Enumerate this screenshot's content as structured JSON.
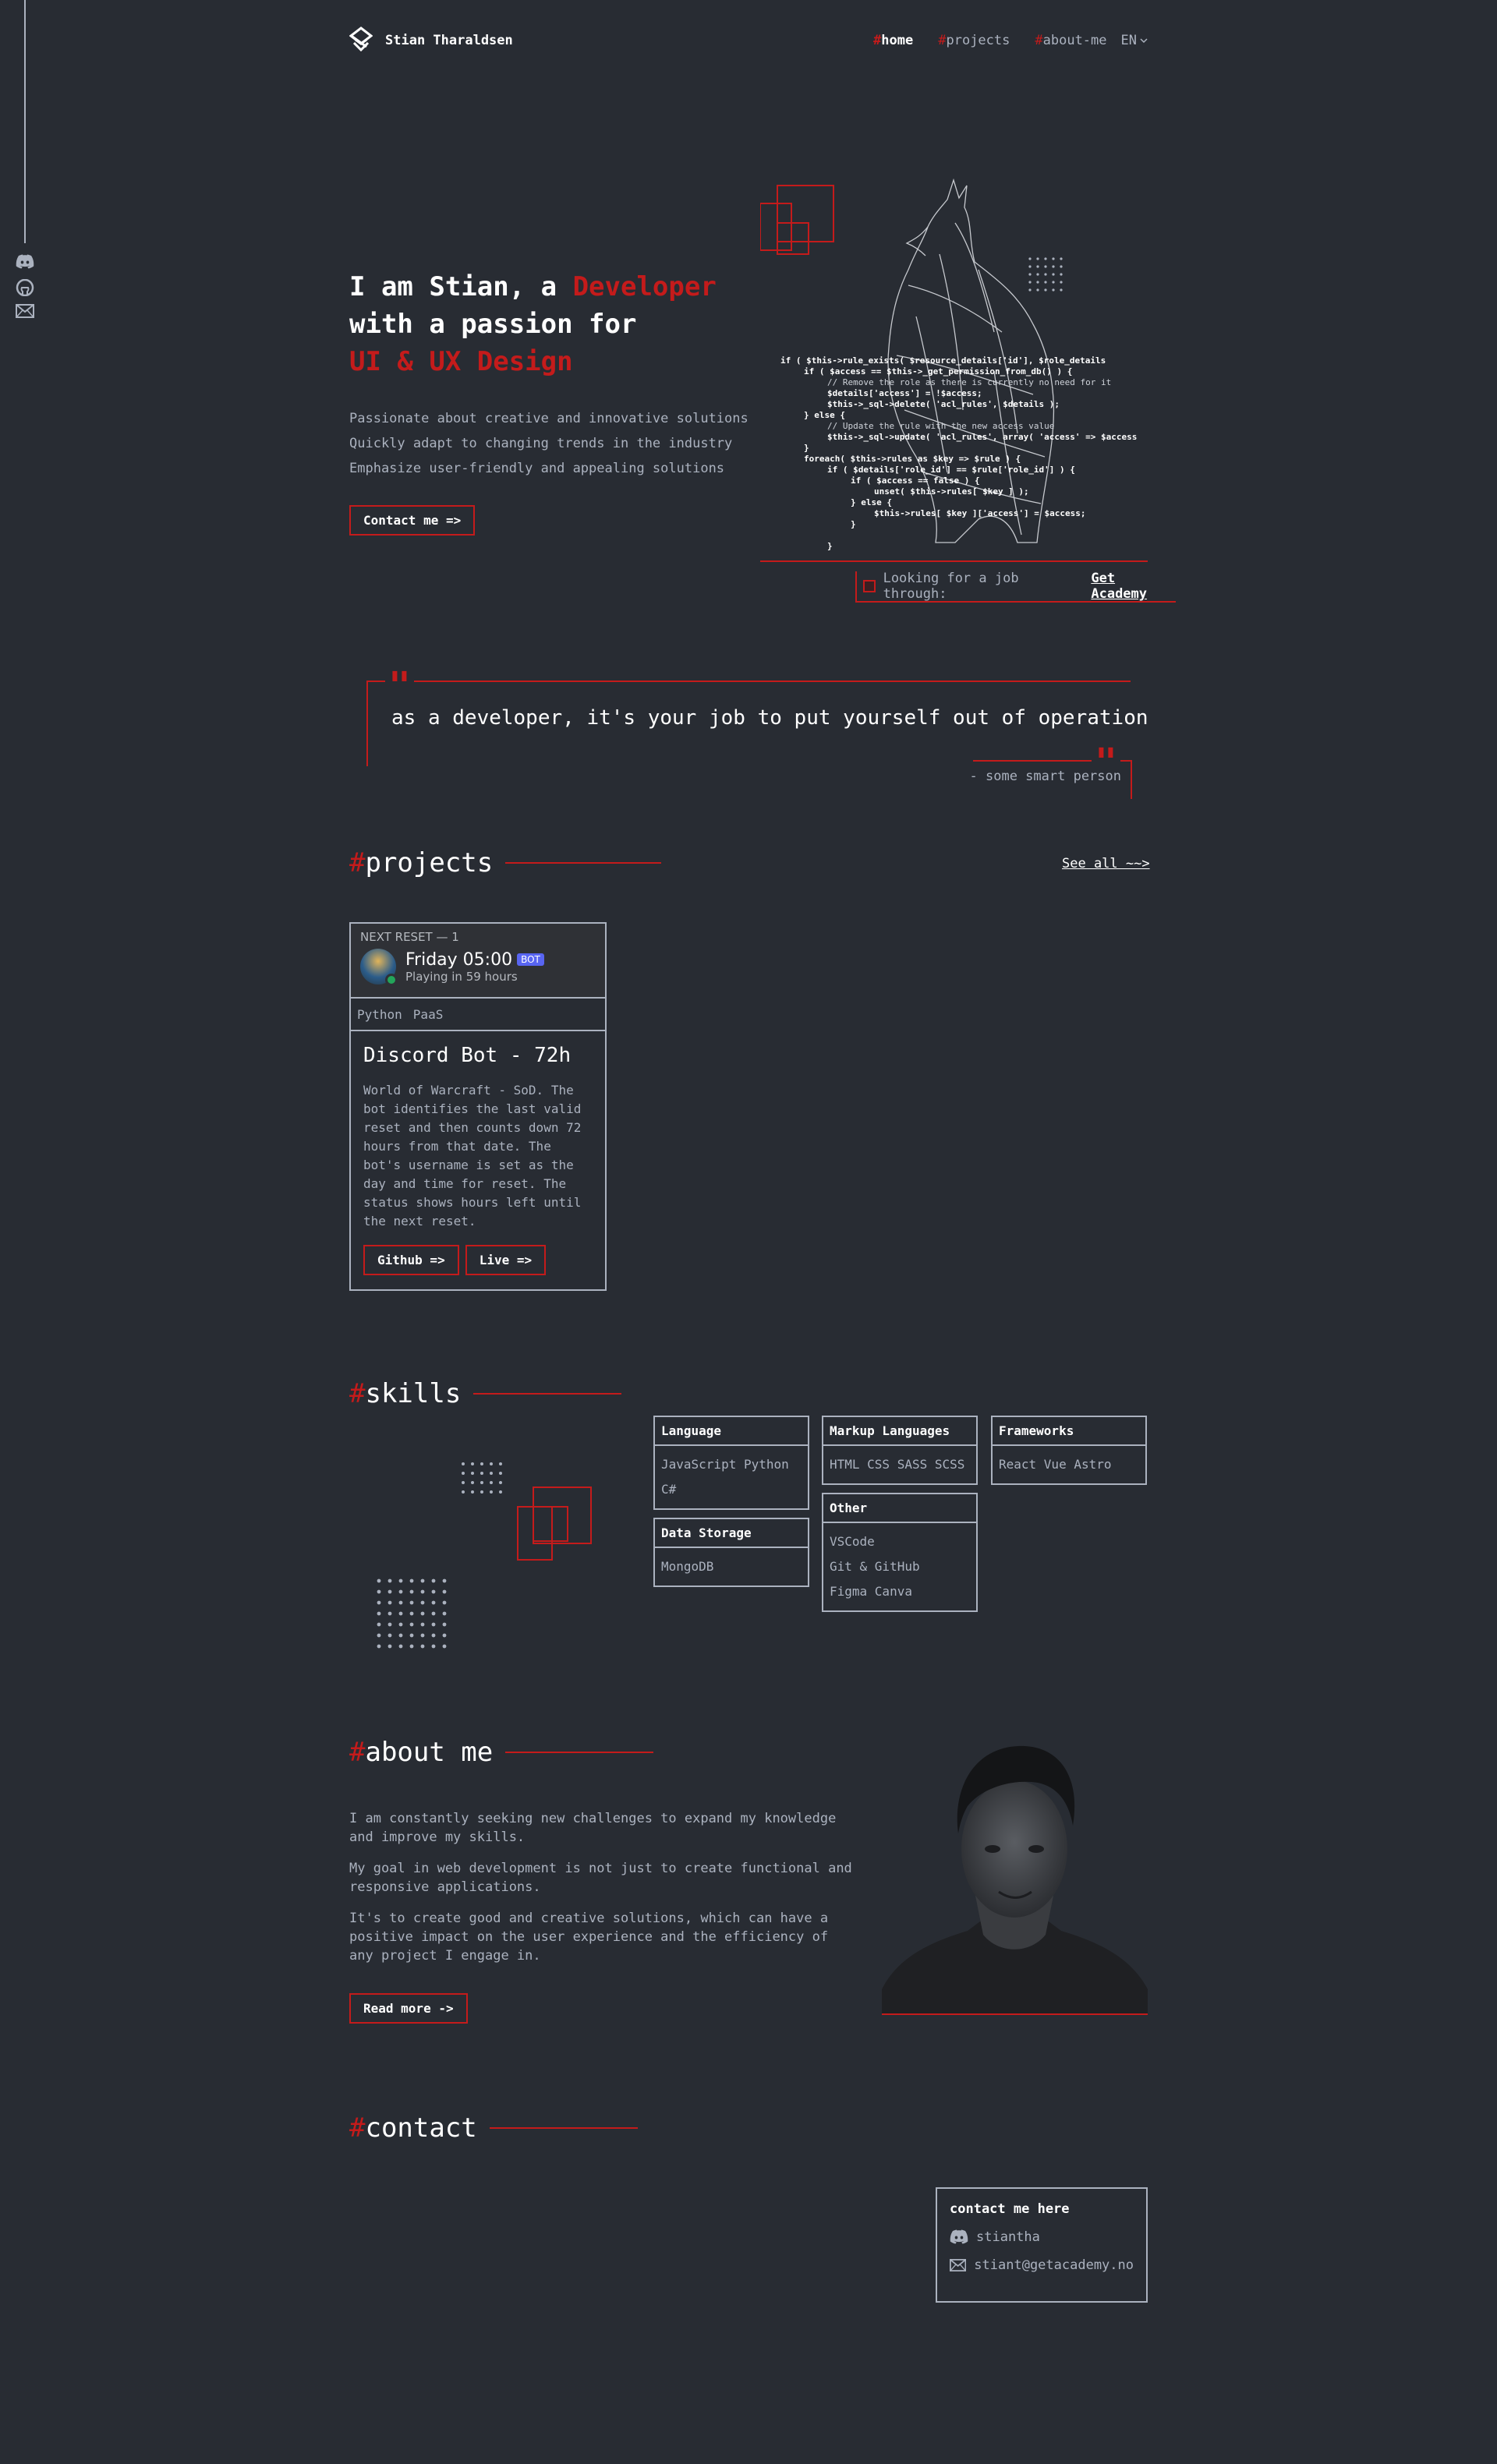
{
  "brand": {
    "name": "Stian Tharaldsen"
  },
  "nav": {
    "items": [
      {
        "hash": "#",
        "label": "home"
      },
      {
        "hash": "#",
        "label": "projects"
      },
      {
        "hash": "#",
        "label": "about-me"
      }
    ],
    "lang": "EN"
  },
  "rail": {
    "icons": [
      "discord-icon",
      "github-icon",
      "email-icon"
    ]
  },
  "hero": {
    "line1_a": "I am Stian, a ",
    "line1_b": "Developer",
    "line2": "with a passion for",
    "line3": "UI & UX Design",
    "desc": [
      "Passionate about creative and innovative solutions",
      "Quickly adapt to changing trends in the industry",
      "Emphasize user-friendly and appealing solutions"
    ],
    "button": "Contact me =>",
    "status_text": "Looking for a job through:",
    "status_link": "Get Academy"
  },
  "quote": {
    "text": "as a developer, it's your job to put yourself out of operation",
    "author": "- some smart person"
  },
  "projects": {
    "hash": "#",
    "title": "projects",
    "see_all": "See all ~~>",
    "card": {
      "preview_head": "NEXT RESET — 1",
      "preview_title": "Friday 05:00",
      "preview_badge": "BOT",
      "preview_sub": "Playing in 59 hours",
      "tags": [
        "Python",
        "PaaS"
      ],
      "title": "Discord Bot - 72h",
      "desc": "World of Warcraft - SoD. The bot identifies the last valid reset and then counts down 72 hours from that date. The bot's username is set as the day and time for reset. The status shows hours left until the next reset.",
      "btn_github": "Github =>",
      "btn_live": "Live =>"
    }
  },
  "skills": {
    "hash": "#",
    "title": "skills",
    "groups": {
      "language": {
        "head": "Language",
        "items": [
          "JavaScript Python",
          "C#"
        ]
      },
      "storage": {
        "head": "Data Storage",
        "items": [
          "MongoDB"
        ]
      },
      "markup": {
        "head": "Markup Languages",
        "items": [
          "HTML CSS SASS SCSS"
        ]
      },
      "other": {
        "head": "Other",
        "items": [
          "VSCode",
          "Git & GitHub",
          "Figma Canva"
        ]
      },
      "frameworks": {
        "head": "Frameworks",
        "items": [
          "React Vue Astro"
        ]
      }
    }
  },
  "about": {
    "hash": "#",
    "title": "about me",
    "paragraphs": [
      "I am constantly seeking new challenges to expand my knowledge and improve my skills.",
      "My goal in web development is not just to create functional and responsive applications.",
      "It's to create good and creative solutions, which can have a positive impact on the user experience and the efficiency of any project I engage in."
    ],
    "button": "Read more ->"
  },
  "contact": {
    "hash": "#",
    "title": "contact",
    "box_title": "contact me here",
    "discord": "stiantha",
    "email": "stiant@getacademy.no"
  },
  "colors": {
    "accent": "#c41b1b",
    "background": "#282c33",
    "text": "#abb2bf",
    "heading": "#ffffff"
  }
}
